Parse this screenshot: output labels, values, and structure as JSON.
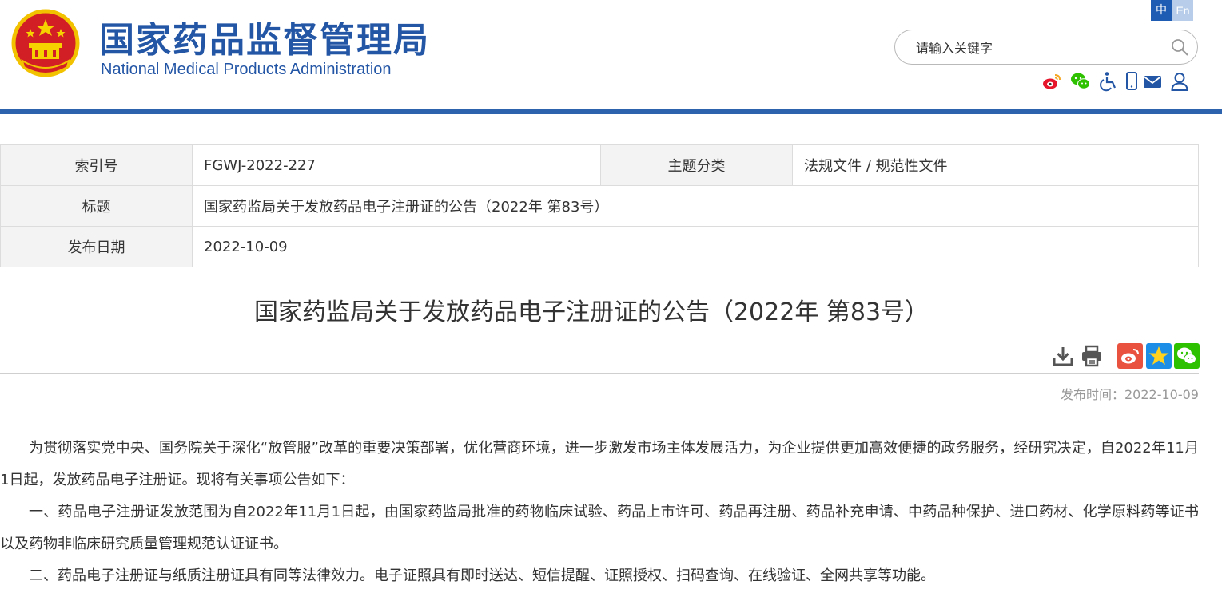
{
  "header": {
    "site_title_cn": "国家药品监督管理局",
    "site_title_en": "National Medical Products Administration",
    "lang_zh": "中",
    "lang_en": "En",
    "search_placeholder": "请输入关键字",
    "tool_icons": [
      "weibo-icon",
      "wechat-icon",
      "accessibility-icon",
      "mobile-icon",
      "mail-icon",
      "user-icon"
    ]
  },
  "meta": {
    "index_label": "索引号",
    "index_value": "FGWJ-2022-227",
    "category_label": "主题分类",
    "category_value": "法规文件 / 规范性文件",
    "title_label": "标题",
    "title_value": "国家药监局关于发放药品电子注册证的公告（2022年 第83号）",
    "date_label": "发布日期",
    "date_value": "2022-10-09"
  },
  "article": {
    "title": "国家药监局关于发放药品电子注册证的公告（2022年 第83号）",
    "pub_time": "发布时间：2022-10-09",
    "share_icons": [
      "download-icon",
      "print-icon",
      "weibo-share-icon",
      "qzone-share-icon",
      "wechat-share-icon"
    ],
    "paragraphs": [
      "为贯彻落实党中央、国务院关于深化“放管服”改革的重要决策部署，优化营商环境，进一步激发市场主体发展活力，为企业提供更加高效便捷的政务服务，经研究决定，自2022年11月1日起，发放药品电子注册证。现将有关事项公告如下：",
      "一、药品电子注册证发放范围为自2022年11月1日起，由国家药监局批准的药物临床试验、药品上市许可、药品再注册、药品补充申请、中药品种保护、进口药材、化学原料药等证书以及药物非临床研究质量管理规范认证证书。",
      "二、药品电子注册证与纸质注册证具有同等法律效力。电子证照具有即时送达、短信提醒、证照授权、扫码查询、在线验证、全网共享等功能。"
    ]
  },
  "colors": {
    "brand_blue": "#2456a6",
    "header_rule": "#2d62ad",
    "lang_active": "#1e5cb3",
    "lang_inactive": "#b7cde9",
    "weibo_red": "#e6162d",
    "wechat_green": "#2dc100",
    "qzone_blue": "#1d8ee8"
  }
}
